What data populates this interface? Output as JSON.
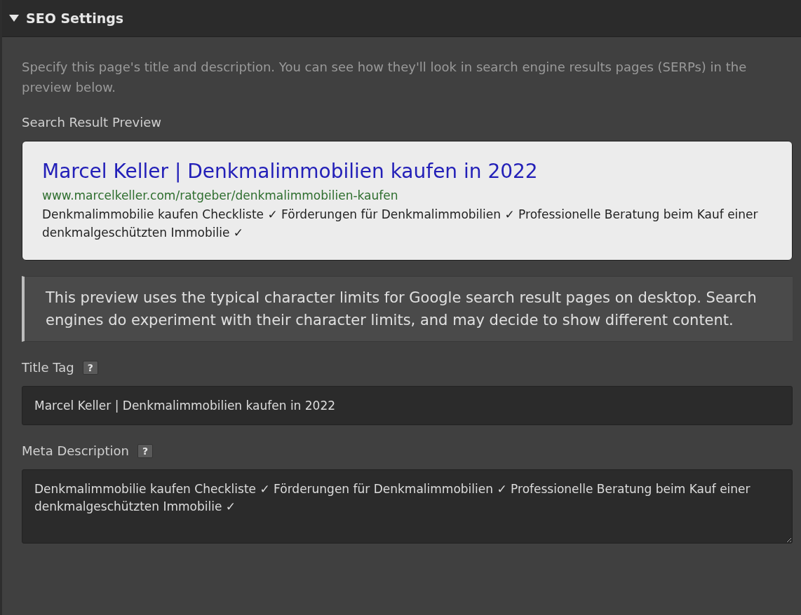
{
  "section": {
    "title": "SEO Settings",
    "expanded": true
  },
  "intro": "Specify this page's title and description. You can see how they'll look in search engine results pages (SERPs) in the preview below.",
  "preview": {
    "label": "Search Result Preview",
    "title": "Marcel Keller | Denkmalimmobilien kaufen in 2022",
    "url": "www.marcelkeller.com/ratgeber/denkmalimmobilien-kaufen",
    "snippet": "Denkmalimmobilie kaufen Checkliste ✓ Förderungen für Denkmalimmobilien ✓ Professionelle Beratung beim Kauf einer denkmalgeschützten Immobilie ✓"
  },
  "note": "This preview uses the typical character limits for Google search result pages on desktop. Search engines do experiment with their character limits, and may decide to show different content.",
  "fields": [
    {
      "kind": "input",
      "label": "Title Tag",
      "help": "?",
      "value": "Marcel Keller | Denkmalimmobilien kaufen in 2022"
    },
    {
      "kind": "textarea",
      "label": "Meta Description",
      "help": "?",
      "value": "Denkmalimmobilie kaufen Checkliste ✓ Förderungen für Denkmalimmobilien ✓ Professionelle Beratung beim Kauf einer denkmalgeschützten Immobilie ✓"
    }
  ]
}
